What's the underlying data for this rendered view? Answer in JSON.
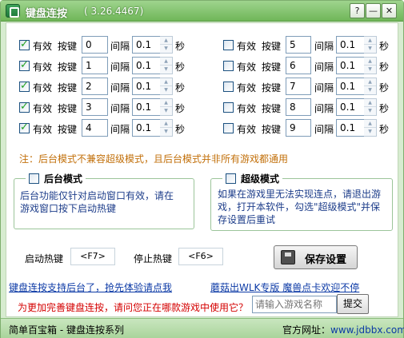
{
  "window": {
    "title": "键盘连按",
    "version": "( 3.26.4467)",
    "help_glyph": "?",
    "minimize_glyph": "—",
    "close_glyph": "✕"
  },
  "keys": {
    "enabled_label": "有效",
    "key_label": "按键",
    "interval_label": "间隔",
    "unit_label": "秒",
    "rows": [
      {
        "checked": true,
        "key": "0",
        "interval": "0.1"
      },
      {
        "checked": true,
        "key": "1",
        "interval": "0.1"
      },
      {
        "checked": true,
        "key": "2",
        "interval": "0.1"
      },
      {
        "checked": true,
        "key": "3",
        "interval": "0.1"
      },
      {
        "checked": true,
        "key": "4",
        "interval": "0.1"
      },
      {
        "checked": false,
        "key": "5",
        "interval": "0.1"
      },
      {
        "checked": false,
        "key": "6",
        "interval": "0.1"
      },
      {
        "checked": false,
        "key": "7",
        "interval": "0.1"
      },
      {
        "checked": false,
        "key": "8",
        "interval": "0.1"
      },
      {
        "checked": false,
        "key": "9",
        "interval": "0.1"
      }
    ]
  },
  "note": "注：后台模式不兼容超级模式，且后台模式并非所有游戏都通用",
  "background_mode": {
    "title": "后台模式",
    "checked": false,
    "line1": "后台功能仅针对启动窗口有效，请在",
    "line2": "游戏窗口按下启动热键"
  },
  "super_mode": {
    "title": "超级模式",
    "checked": false,
    "line1": "如果在游戏里无法实现连点，请退出游",
    "line2": "戏，打开本软件，勾选\"超级模式\"并保",
    "line3": "存设置后重试"
  },
  "hotkeys": {
    "start_label": "启动热键",
    "start_value": "<F7>",
    "stop_label": "停止热键",
    "stop_value": "<F6>"
  },
  "save_button": "保存设置",
  "links": {
    "left": "键盘连按支持后台了，抢先体验请点我",
    "right": "蘑菇出WLK专版 魔兽点卡欢迎不停"
  },
  "survey": {
    "question": "为更加完善键盘连按，请问您正在哪款游戏中使用它？",
    "placeholder": "请输入游戏名称",
    "submit": "提交"
  },
  "status": {
    "left": "简单百宝箱 - 键盘连按系列",
    "site_label": "官方网址：",
    "site_url": "www.jdbbx.com"
  },
  "colors": {
    "title_bar": "#8cc97a",
    "note": "#c2700b",
    "link": "#0c3aa6",
    "question": "#d40000"
  }
}
